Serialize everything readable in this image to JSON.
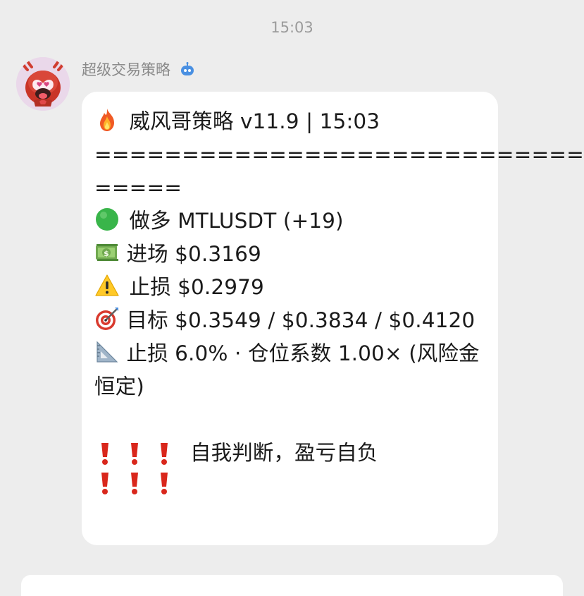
{
  "timestamp": "15:03",
  "sender": {
    "name": "超级交易策略",
    "avatar_icon": "lobster-mascot-avatar",
    "badge_icon": "bot-icon"
  },
  "message": {
    "header_icon": "fire-icon",
    "header_text": "威风哥策略 v11.9 | 15:03",
    "divider_1": "============================",
    "divider_2": "=====",
    "signal_icon": "green-circle-icon",
    "signal_text": "做多 MTLUSDT (+19)",
    "entry_icon": "money-icon",
    "entry_text": "进场 $0.3169",
    "stop_icon": "warning-icon",
    "stop_text": "止损 $0.2979",
    "target_icon": "target-icon",
    "target_text": "目标 $0.3549 / $0.3834 / $0.4120",
    "risk_icon": "triangle-ruler-icon",
    "risk_text": "止损 6.0% · 仓位系数 1.00× (风险金恒定)",
    "disclaimer_text": "自我判断，盈亏自负",
    "exclamation_icon": "red-exclamation-icon"
  },
  "colors": {
    "background": "#ededed",
    "bubble": "#ffffff",
    "text": "#1b1b1b",
    "muted": "#8a8a8a",
    "exclamation": "#d9271c",
    "signal_green": "#39b54a",
    "bot_blue": "#4a90e2"
  }
}
